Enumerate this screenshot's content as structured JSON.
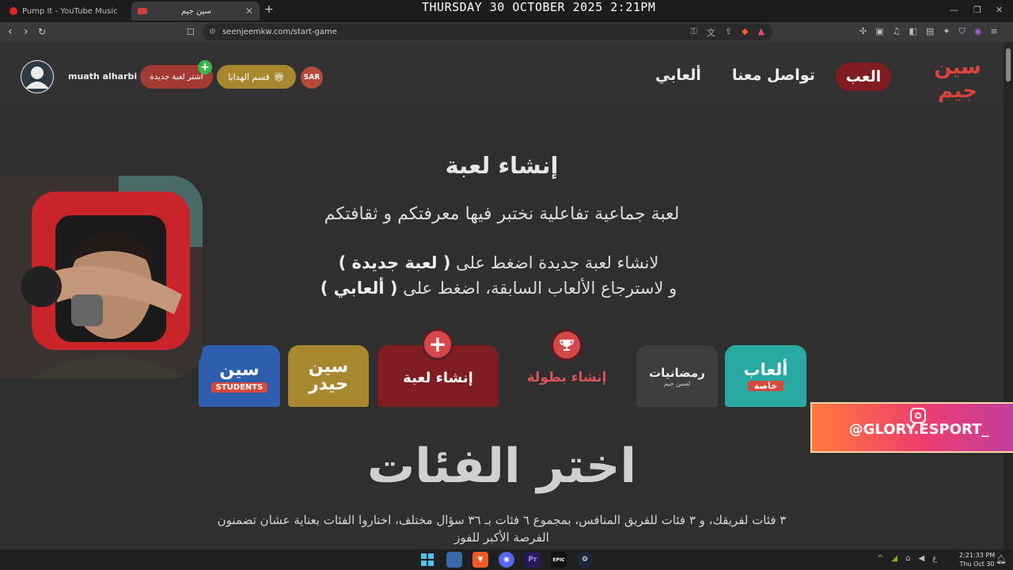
{
  "overlay_clock": "THURSDAY 30 OCTOBER 2025 2:21PM",
  "browser": {
    "tabs": [
      {
        "title": "Pump It - YouTube Music"
      },
      {
        "title": "سين جيم"
      }
    ],
    "url": "seenjeemkw.com/start-game"
  },
  "header": {
    "logo_text": "سين جيم",
    "nav": {
      "play": "العب",
      "contact": "تواصل معنا",
      "my_games": "ألعابي"
    },
    "currency": "SAR",
    "gifts_label": "قسم الهدايا",
    "buy_game_label": "اشتر لعبة جديدة",
    "plus_symbol": "+",
    "username": "muath alharbi"
  },
  "main": {
    "title": "إنشاء لعبة",
    "subtitle": "لعبة جماعية تفاعلية نختبر فيها معرفتكم و ثقافتكم",
    "instructions": {
      "line1_prefix": "لانشاء لعبة جديدة اضغط على ",
      "line1_bold": "( لعبة جديدة )",
      "line2_prefix": "و لاسترجاع الألعاب السابقة، اضغط على ",
      "line2_bold": "( ألعابي )"
    },
    "cards": {
      "special": {
        "title": "ألعاب",
        "tag": "خاصة"
      },
      "ramadan": {
        "title": "رمضانيات",
        "sub": "لسين جيم"
      },
      "tournament": {
        "label": "إنشاء بطولة",
        "icon": "trophy-icon"
      },
      "new_game": {
        "label": "إنشاء لعبة",
        "icon": "plus-icon"
      },
      "haydar": {
        "title": "سين حيدر"
      },
      "students": {
        "title": "سين",
        "tag": "STUDENTS"
      }
    },
    "categories_title": "اختر الفئات",
    "categories_desc": "٣ فئات لفريقك، و ٣ فئات للفريق المنافس، بمجموع ٦ فئات بـ ٣٦ سؤال مختلف، اختاروا الفئات بعناية عشان تضمنون الفرصة الأكبر للفوز"
  },
  "overlays": {
    "social_handle": "@GLORY.ESPORT_"
  },
  "taskbar": {
    "time": "2:21:33 PM",
    "date": "Thu Oct 30",
    "lang": "ع"
  },
  "colors": {
    "brand_red": "#7f1d22",
    "gold": "#a8872f",
    "teal": "#29a9a4",
    "blue": "#2d5fae",
    "page_bg": "#2f2f2f"
  }
}
